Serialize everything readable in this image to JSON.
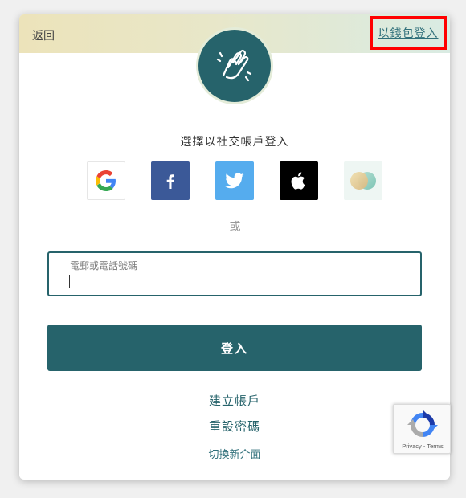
{
  "header": {
    "back_label": "返回",
    "wallet_login_label": "以錢包登入"
  },
  "social": {
    "title": "選擇以社交帳戶登入",
    "buttons": [
      {
        "name": "google",
        "icon": "google-icon"
      },
      {
        "name": "facebook",
        "icon": "facebook-icon",
        "color": "#3b5998"
      },
      {
        "name": "twitter",
        "icon": "twitter-icon",
        "color": "#55acee"
      },
      {
        "name": "apple",
        "icon": "apple-icon",
        "color": "#000000"
      },
      {
        "name": "wallet",
        "icon": "wallet-circles-icon"
      }
    ]
  },
  "divider": {
    "text": "或"
  },
  "form": {
    "field_label": "電郵或電話號碼",
    "field_value": "",
    "login_label": "登入"
  },
  "links": {
    "create_account": "建立帳戶",
    "reset_password": "重設密碼",
    "switch_interface": "切換新介面"
  },
  "recaptcha": {
    "text": "Privacy - Terms"
  },
  "colors": {
    "primary": "#26636b",
    "highlight_border": "#ff0000"
  }
}
